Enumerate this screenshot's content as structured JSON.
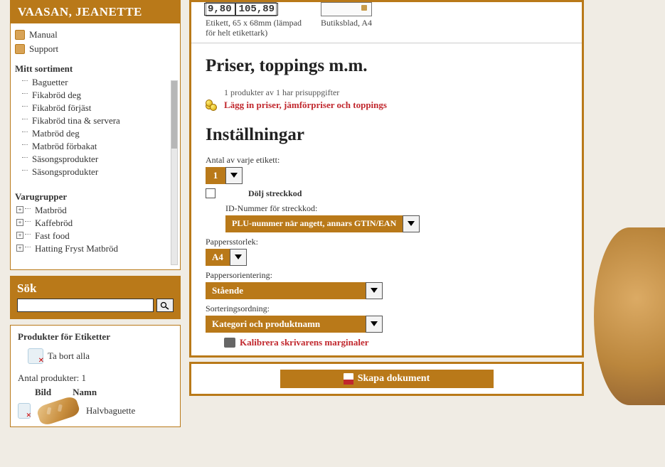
{
  "sidebar": {
    "user": "VAASAN, JEANETTE",
    "topLinks": {
      "manual": "Manual",
      "support": "Support"
    },
    "sortimentTitle": "Mitt sortiment",
    "sortiment": [
      "Baguetter",
      "Fikabröd deg",
      "Fikabröd förjäst",
      "Fikabröd tina & servera",
      "Matbröd deg",
      "Matbröd förbakat",
      "Säsongsprodukter",
      "Säsongsprodukter"
    ],
    "varugrupperTitle": "Varugrupper",
    "varugrupper": [
      "Matbröd",
      "Kaffebröd",
      "Fast food",
      "Hatting Fryst Matbröd"
    ],
    "searchTitle": "Sök",
    "products": {
      "title": "Produkter för Etiketter",
      "removeAll": "Ta bort alla",
      "countLabel": "Antal produkter: 1",
      "colImage": "Bild",
      "colName": "Namn",
      "items": [
        {
          "name": "Halvbaguette"
        }
      ]
    }
  },
  "main": {
    "templates": [
      {
        "price1": "9,80",
        "price2": "105,89",
        "caption": "Etikett, 65 x 68mm (lämpad för helt etikettark)"
      },
      {
        "caption": "Butiksblad, A4"
      }
    ],
    "pricesHeading": "Priser, toppings m.m.",
    "priceInfo": "1 produkter av 1 har prisuppgifter",
    "priceLink": "Lägg in priser, jämförpriser och toppings",
    "settingsHeading": "Inställningar",
    "fields": {
      "qtyLabel": "Antal av varje etikett:",
      "qtyValue": "1",
      "hideBarcode": "Dölj streckkod",
      "idLabel": "ID-Nummer för streckkod:",
      "idValue": "PLU-nummer när angett, annars GTIN/EAN",
      "paperSizeLabel": "Pappersstorlek:",
      "paperSizeValue": "A4",
      "orientLabel": "Pappersorientering:",
      "orientValue": "Stående",
      "sortLabel": "Sorteringsordning:",
      "sortValue": "Kategori och produktnamn",
      "calibrate": "Kalibrera skrivarens marginaler"
    },
    "createButton": "Skapa dokument"
  }
}
